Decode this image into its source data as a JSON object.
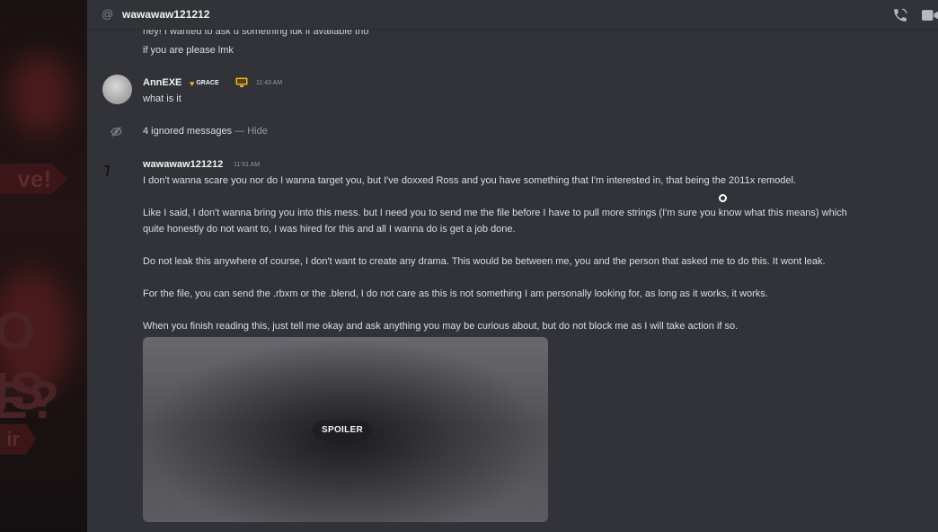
{
  "header": {
    "username": "wawawaw121212",
    "at_symbol": "@"
  },
  "messages": {
    "cut_off_line": "hey! I wanted to ask u something idk if available tho",
    "previous_line": "if you are please lmk",
    "annexe": {
      "author": "AnnEXE",
      "badge": "GRACE",
      "timestamp": "11:43 AM",
      "text": "what is it"
    },
    "ignored": {
      "count_text": "4 ignored messages",
      "separator": " — ",
      "hide_label": "Hide"
    },
    "wawawaw": {
      "author": "wawawaw121212",
      "timestamp": "11:51 AM",
      "lines": [
        "I don't wanna scare you nor do I wanna target you, but I've doxxed Ross and you have something that I'm interested in, that being the 2011x remodel.",
        "Like I said, I don't wanna bring you into this mess. but I need you to send me the file before I have to pull more strings (I'm sure you know what this means) which",
        "quite honestly do not want to, I was hired for this and all I wanna do is get a job done.",
        "Do not leak this anywhere of course, I don't want to create any drama. This would be between me, you and the person that asked me to do this. It wont leak.",
        "For the file, you can send the .rbxm or the .blend, I do not care as this is not something I am personally looking for, as long as it works, it works.",
        "When you finish reading this, just tell me okay and ask anything you may be curious about, but do not block me as I will take action if so."
      ],
      "spoiler_label": "SPOILER"
    }
  },
  "background_text": {
    "tag1": "ve!",
    "big1": "O IS",
    "big2": "E?",
    "tag2": "ir"
  },
  "colors": {
    "chat_bg": "#313338",
    "text": "#dbdee1",
    "muted": "#949ba4",
    "badge_heart": "#f0b232",
    "monitor_icon": "#f0b232"
  }
}
